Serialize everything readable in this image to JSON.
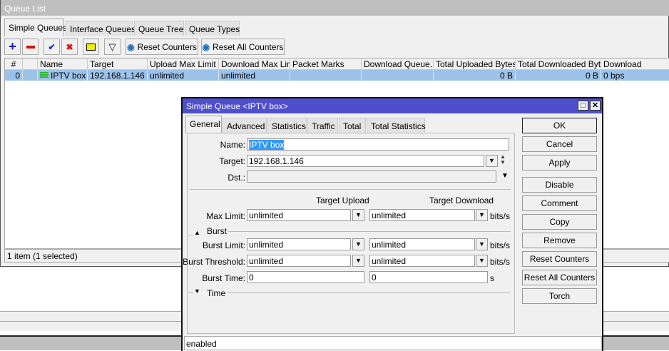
{
  "queue_list": {
    "title": "Queue List",
    "tabs": [
      {
        "label": "Simple Queues",
        "active": true
      },
      {
        "label": "Interface Queues"
      },
      {
        "label": "Queue Tree"
      },
      {
        "label": "Queue Types"
      }
    ],
    "toolbar": {
      "reset_counters": "Reset Counters",
      "reset_all_counters": "Reset All Counters"
    },
    "columns": [
      "#",
      "",
      "Name",
      "Target",
      "Upload Max Limit",
      "Download Max Limit",
      "Packet Marks",
      "Download Queue...",
      "Total Uploaded Bytes",
      "Total Downloaded Bytes",
      "Download"
    ],
    "rows": [
      {
        "num": "0",
        "name": "IPTV box",
        "target": "192.168.1.146",
        "upload_max": "unlimited",
        "download_max": "unlimited",
        "packet_marks": "",
        "download_queue": "",
        "total_up": "0 B",
        "total_down": "0 B",
        "download": "0 bps",
        "selected": true
      }
    ],
    "status": "1 item (1 selected)"
  },
  "dialog": {
    "title": "Simple Queue <IPTV box>",
    "tabs": [
      {
        "label": "General",
        "active": true
      },
      {
        "label": "Advanced"
      },
      {
        "label": "Statistics"
      },
      {
        "label": "Traffic"
      },
      {
        "label": "Total"
      },
      {
        "label": "Total Statistics"
      }
    ],
    "fields": {
      "name_label": "Name:",
      "name": "IPTV box",
      "target_label": "Target:",
      "target": "192.168.1.146",
      "dst_label": "Dst.:",
      "dst": "",
      "target_upload": "Target Upload",
      "target_download": "Target Download",
      "max_limit_label": "Max Limit:",
      "max_limit_up": "unlimited",
      "max_limit_down": "unlimited",
      "burst_section": "Burst",
      "burst_limit_label": "Burst Limit:",
      "burst_limit_up": "unlimited",
      "burst_limit_down": "unlimited",
      "burst_threshold_label": "Burst Threshold:",
      "burst_threshold_up": "unlimited",
      "burst_threshold_down": "unlimited",
      "burst_time_label": "Burst Time:",
      "burst_time_up": "0",
      "burst_time_down": "0",
      "unit_bits": "bits/s",
      "unit_s": "s",
      "time_section": "Time"
    },
    "buttons": [
      "OK",
      "Cancel",
      "Apply",
      "Disable",
      "Comment",
      "Copy",
      "Remove",
      "Reset Counters",
      "Reset All Counters",
      "Torch"
    ],
    "status": "enabled"
  },
  "colors": {
    "dialog_title": "#4f4fcd",
    "selected_row": "#9cc2ea",
    "queue_icon": "#2db82d"
  }
}
